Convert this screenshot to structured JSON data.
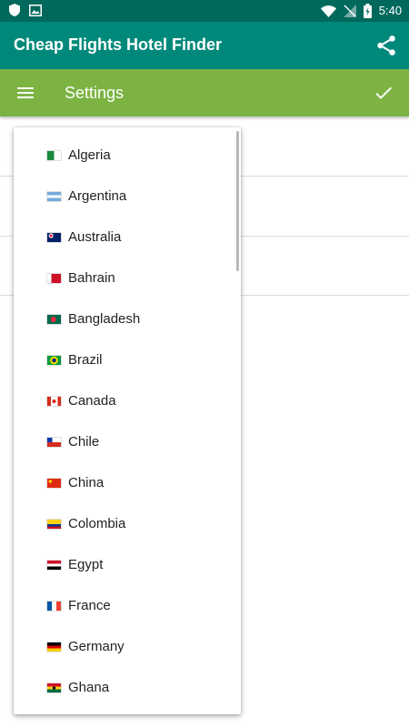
{
  "status_bar": {
    "time": "5:40"
  },
  "app_bar": {
    "title": "Cheap Flights Hotel Finder"
  },
  "settings_bar": {
    "title": "Settings"
  },
  "countries": [
    {
      "name": "Algeria",
      "flag_icon": "algeria-flag-icon"
    },
    {
      "name": "Argentina",
      "flag_icon": "argentina-flag-icon"
    },
    {
      "name": "Australia",
      "flag_icon": "australia-flag-icon"
    },
    {
      "name": "Bahrain",
      "flag_icon": "bahrain-flag-icon"
    },
    {
      "name": "Bangladesh",
      "flag_icon": "bangladesh-flag-icon"
    },
    {
      "name": "Brazil",
      "flag_icon": "brazil-flag-icon"
    },
    {
      "name": "Canada",
      "flag_icon": "canada-flag-icon"
    },
    {
      "name": "Chile",
      "flag_icon": "chile-flag-icon"
    },
    {
      "name": "China",
      "flag_icon": "china-flag-icon"
    },
    {
      "name": "Colombia",
      "flag_icon": "colombia-flag-icon"
    },
    {
      "name": "Egypt",
      "flag_icon": "egypt-flag-icon"
    },
    {
      "name": "France",
      "flag_icon": "france-flag-icon"
    },
    {
      "name": "Germany",
      "flag_icon": "germany-flag-icon"
    },
    {
      "name": "Ghana",
      "flag_icon": "ghana-flag-icon"
    }
  ],
  "colors": {
    "status_bar": "#00695c",
    "app_bar": "#00897b",
    "settings_bar": "#7cb342"
  }
}
